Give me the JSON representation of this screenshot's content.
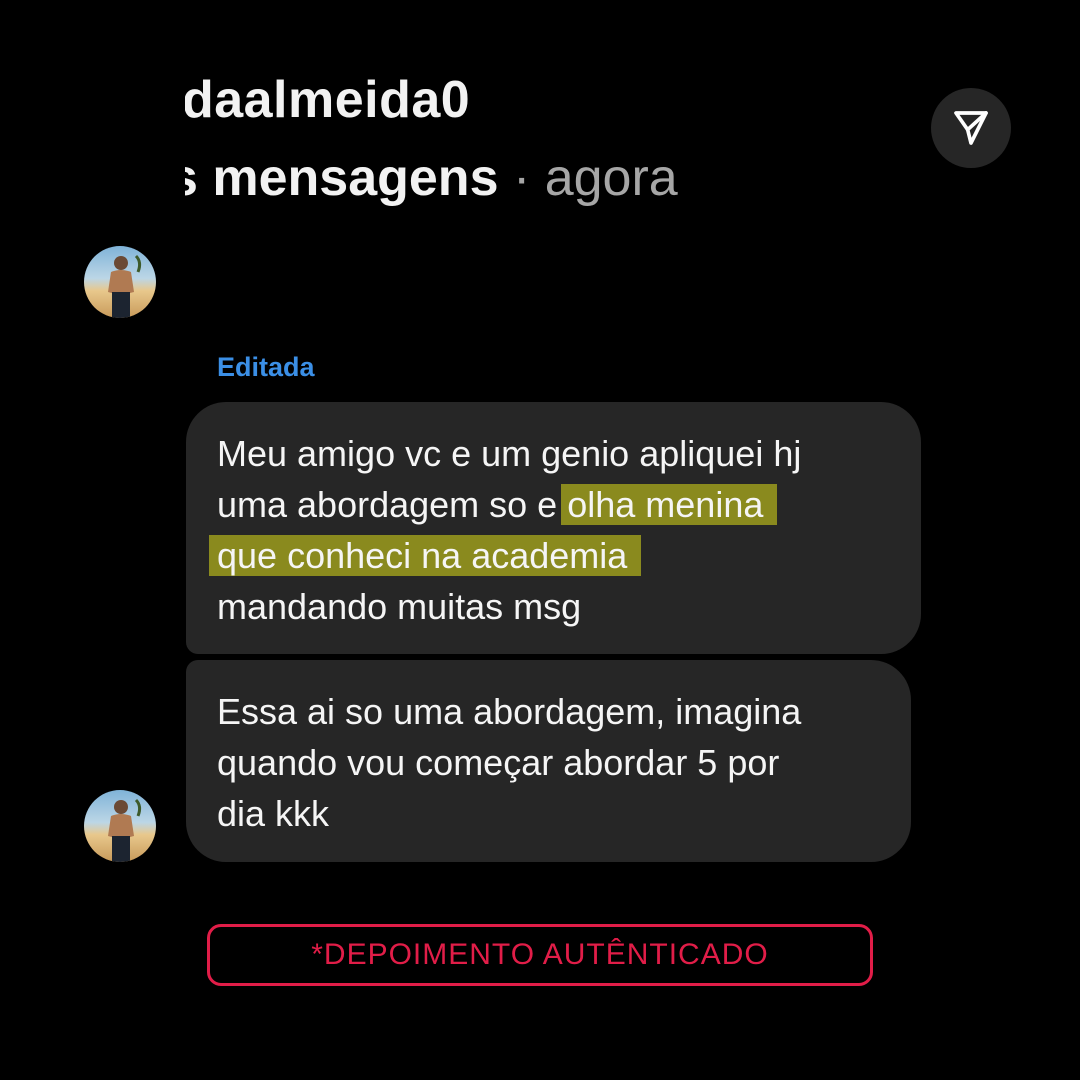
{
  "header": {
    "username": "ıdaalmeida0",
    "subtitle_main": "s mensagens",
    "subtitle_time": " · agora"
  },
  "icons": {
    "send": "paper-plane-icon",
    "avatar": "profile-avatar"
  },
  "edited_label": "Editada",
  "messages": [
    {
      "lines": [
        "Meu amigo vc e um genio apliquei hj",
        "uma abordagem so e ",
        "olha menina",
        "que conheci na academia",
        "mandando muitas msg"
      ]
    },
    {
      "lines": [
        "Essa ai so uma abordagem, imagina",
        "quando vou começar abordar 5 por",
        "dia kkk"
      ]
    }
  ],
  "badge_text": "*DEPOIMENTO AUTÊNTICADO",
  "colors": {
    "background": "#000000",
    "bubble": "#262626",
    "highlight": "#8a8a1e",
    "edited": "#3b8fe6",
    "badge": "#e11d48"
  }
}
